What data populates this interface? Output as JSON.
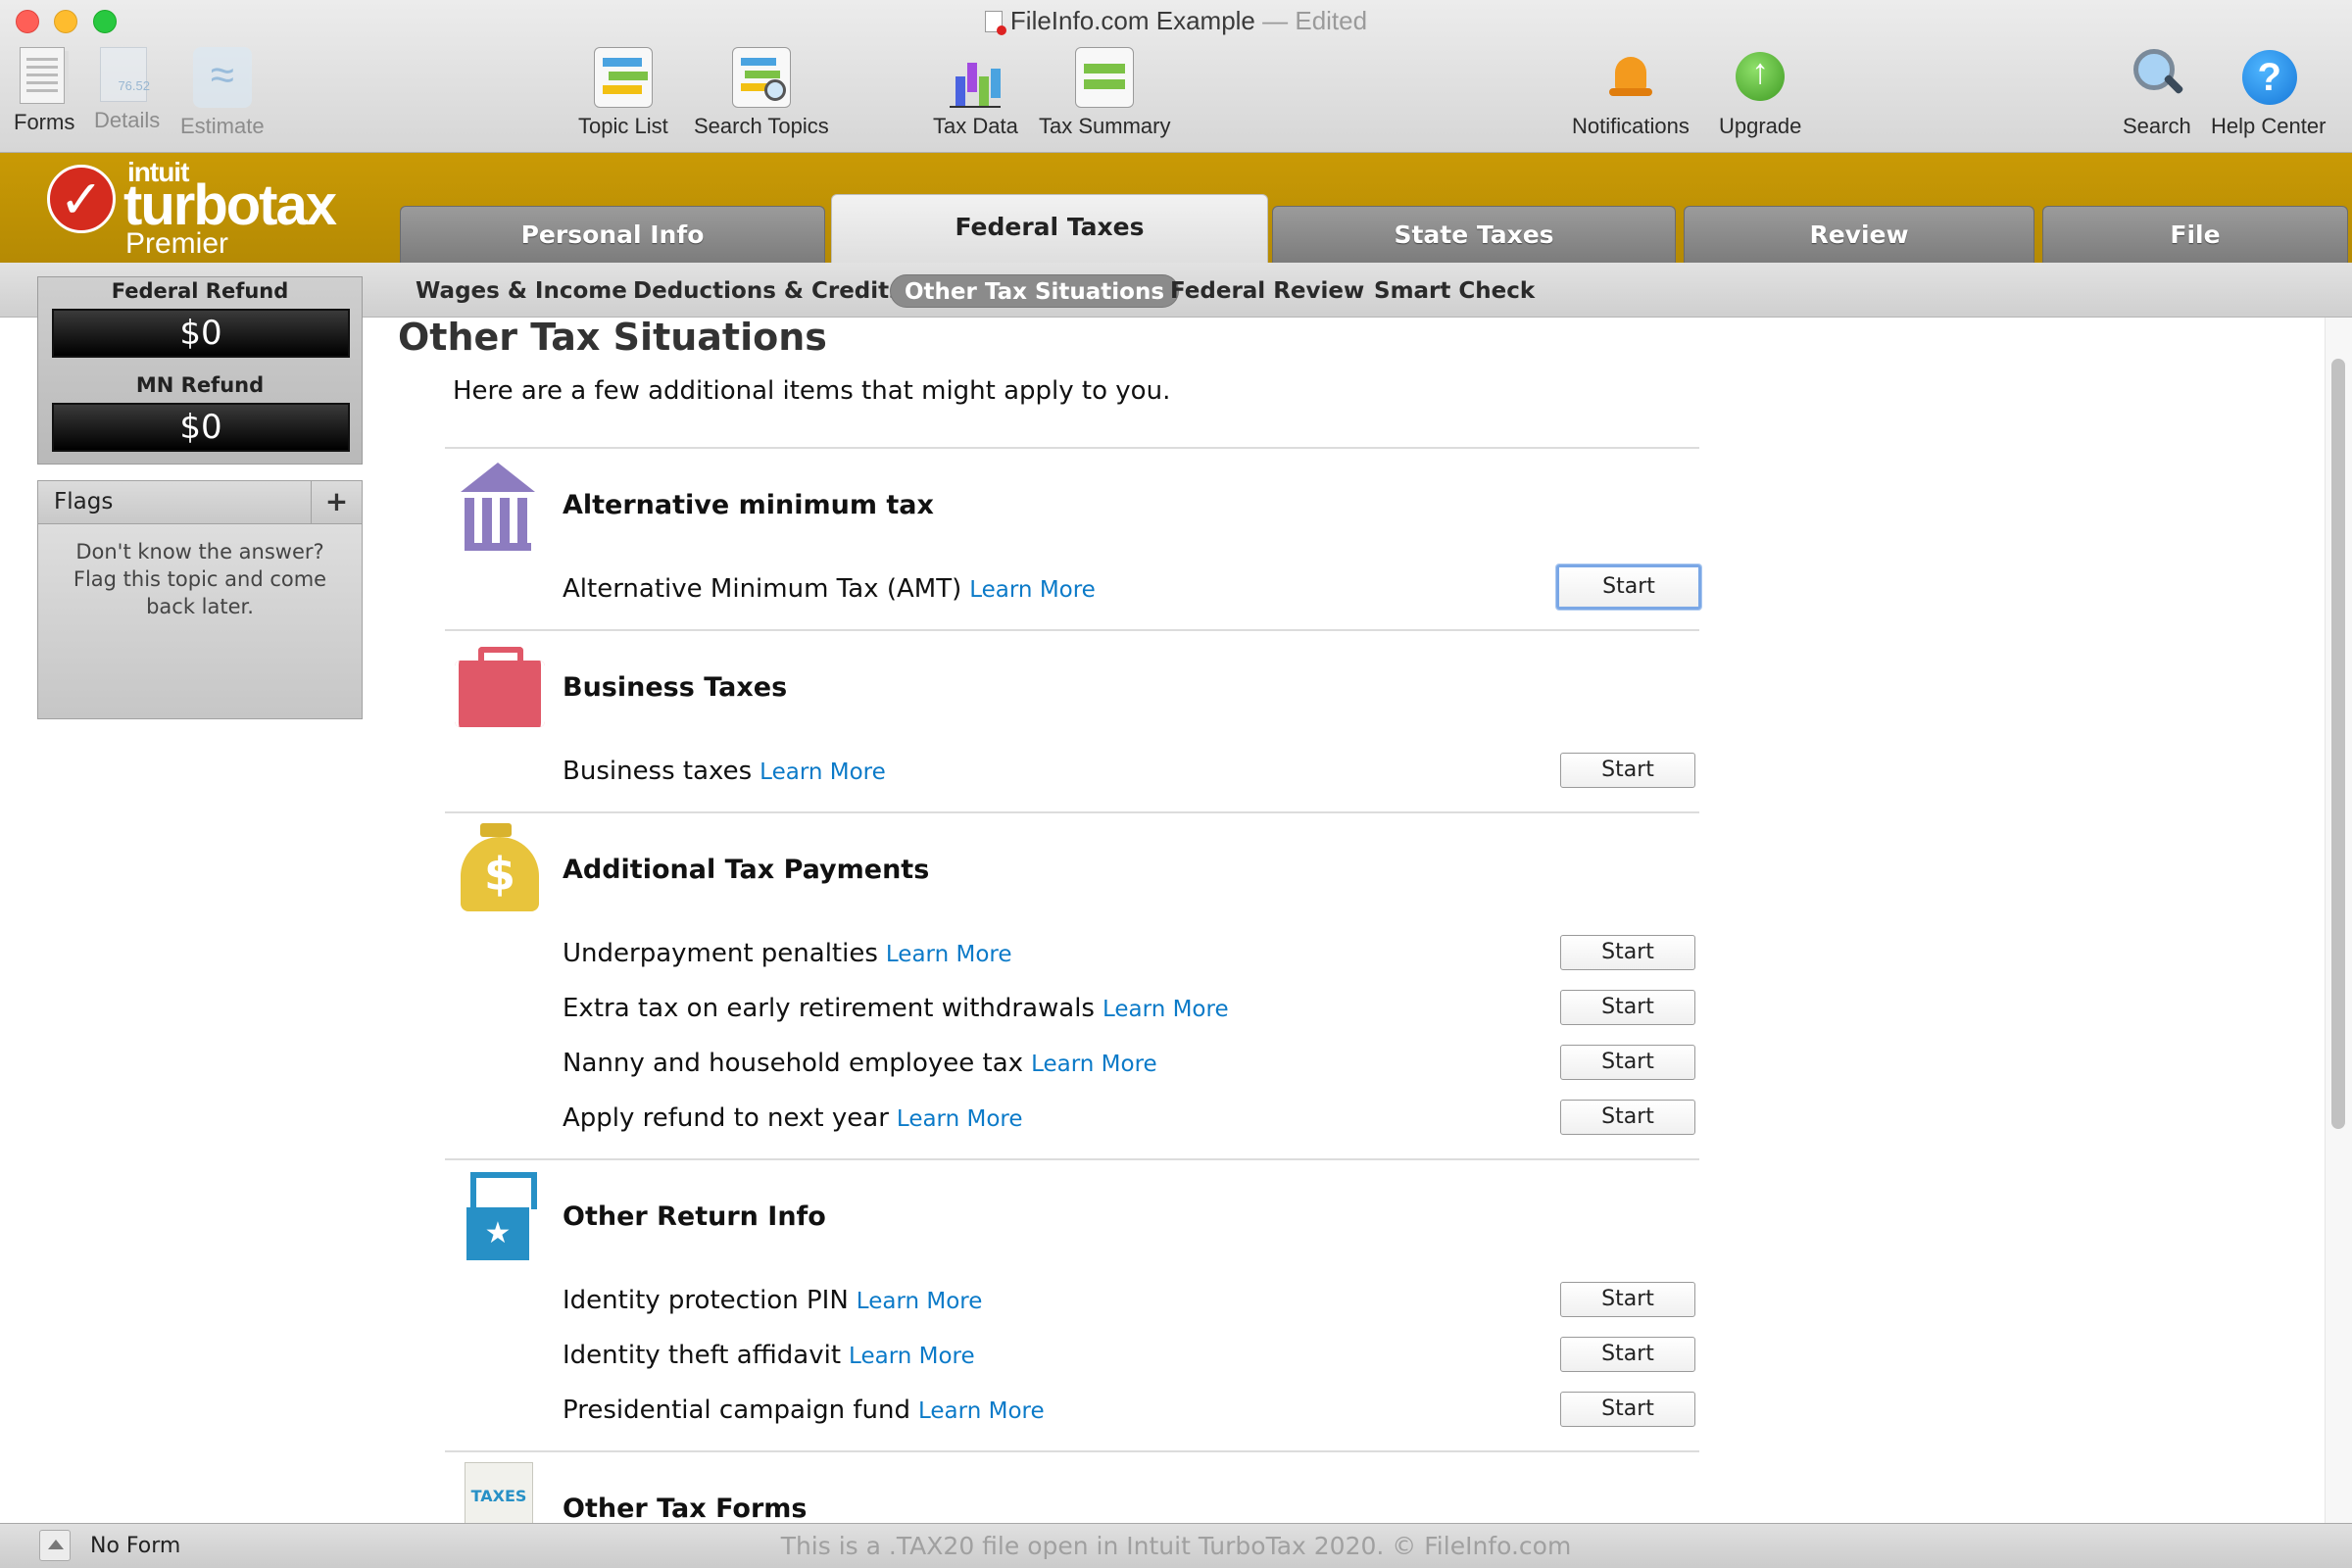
{
  "window": {
    "title": "FileInfo.com Example",
    "edited": "— Edited"
  },
  "toolbar": {
    "forms": "Forms",
    "details": "Details",
    "estimate": "Estimate",
    "topic_list": "Topic List",
    "search_topics": "Search Topics",
    "tax_data": "Tax Data",
    "tax_summary": "Tax Summary",
    "notifications": "Notifications",
    "upgrade": "Upgrade",
    "search": "Search",
    "help_center": "Help Center"
  },
  "brand": {
    "intuit": "intuit",
    "name": "turbotax",
    "edition": "Premier",
    "band_color": "#c29404"
  },
  "main_tabs": [
    {
      "label": "Personal Info",
      "active": false
    },
    {
      "label": "Federal Taxes",
      "active": true
    },
    {
      "label": "State Taxes",
      "active": false
    },
    {
      "label": "Review",
      "active": false
    },
    {
      "label": "File",
      "active": false
    }
  ],
  "subnav": [
    {
      "label": "Wages & Income",
      "active": false
    },
    {
      "label": "Deductions & Credits",
      "active": false
    },
    {
      "label": "Other Tax Situations",
      "active": true
    },
    {
      "label": "Federal Review",
      "active": false
    },
    {
      "label": "Smart Check",
      "active": false
    }
  ],
  "refunds": {
    "federal_label": "Federal Refund",
    "federal_value": "$0",
    "state_label": "MN Refund",
    "state_value": "$0"
  },
  "flags": {
    "title": "Flags",
    "add": "+",
    "text": "Don't know the answer? Flag this topic and come back later."
  },
  "page": {
    "title": "Other Tax Situations",
    "intro": "Here are a few additional items that might apply to you.",
    "learn_more": "Learn More",
    "start": "Start"
  },
  "sections": [
    {
      "title": "Alternative minimum tax",
      "icon": "bank-icon",
      "items": [
        "Alternative Minimum Tax (AMT)"
      ]
    },
    {
      "title": "Business Taxes",
      "icon": "briefcase-icon",
      "items": [
        "Business taxes"
      ]
    },
    {
      "title": "Additional Tax Payments",
      "icon": "money-bag-icon",
      "items": [
        "Underpayment penalties",
        "Extra tax on early retirement withdrawals",
        "Nanny and household employee tax",
        "Apply refund to next year"
      ]
    },
    {
      "title": "Other Return Info",
      "icon": "ballot-box-icon",
      "items": [
        "Identity protection PIN",
        "Identity theft affidavit",
        "Presidential campaign fund"
      ]
    },
    {
      "title": "Other Tax Forms",
      "icon": "tax-forms-icon",
      "items": []
    }
  ],
  "status": {
    "form": "No Form",
    "note": "This is a .TAX20 file open in Intuit TurboTax 2020. © FileInfo.com"
  }
}
